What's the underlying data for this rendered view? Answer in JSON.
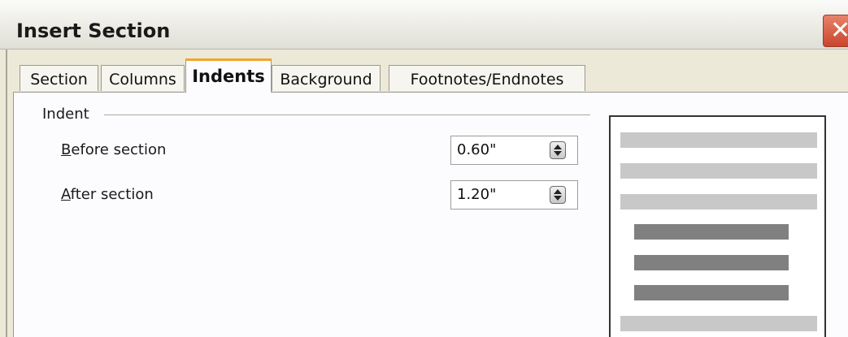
{
  "dialog": {
    "title": "Insert Section",
    "close_glyph": "✕"
  },
  "tabs": [
    {
      "label": "Section",
      "active": false
    },
    {
      "label": "Columns",
      "active": false
    },
    {
      "label": "Indents",
      "active": true
    },
    {
      "label": "Background",
      "active": false
    },
    {
      "label": "Footnotes/Endnotes",
      "active": false
    }
  ],
  "indent": {
    "group_label": "Indent",
    "before": {
      "mnemonic": "B",
      "rest": "efore section",
      "value": "0.60\""
    },
    "after": {
      "mnemonic": "A",
      "rest": "fter section",
      "value": "1.20\""
    }
  },
  "preview": {
    "lines": [
      "full",
      "full",
      "full",
      "indented",
      "indented",
      "indented",
      "full"
    ]
  },
  "colors": {
    "accent_tab": "#f1a52c",
    "close_button": "#d95a40",
    "preview_full_line": "#c8c8c8",
    "preview_indented_line": "#808080"
  },
  "icons": [
    "close-icon",
    "spin-arrows-icon"
  ]
}
